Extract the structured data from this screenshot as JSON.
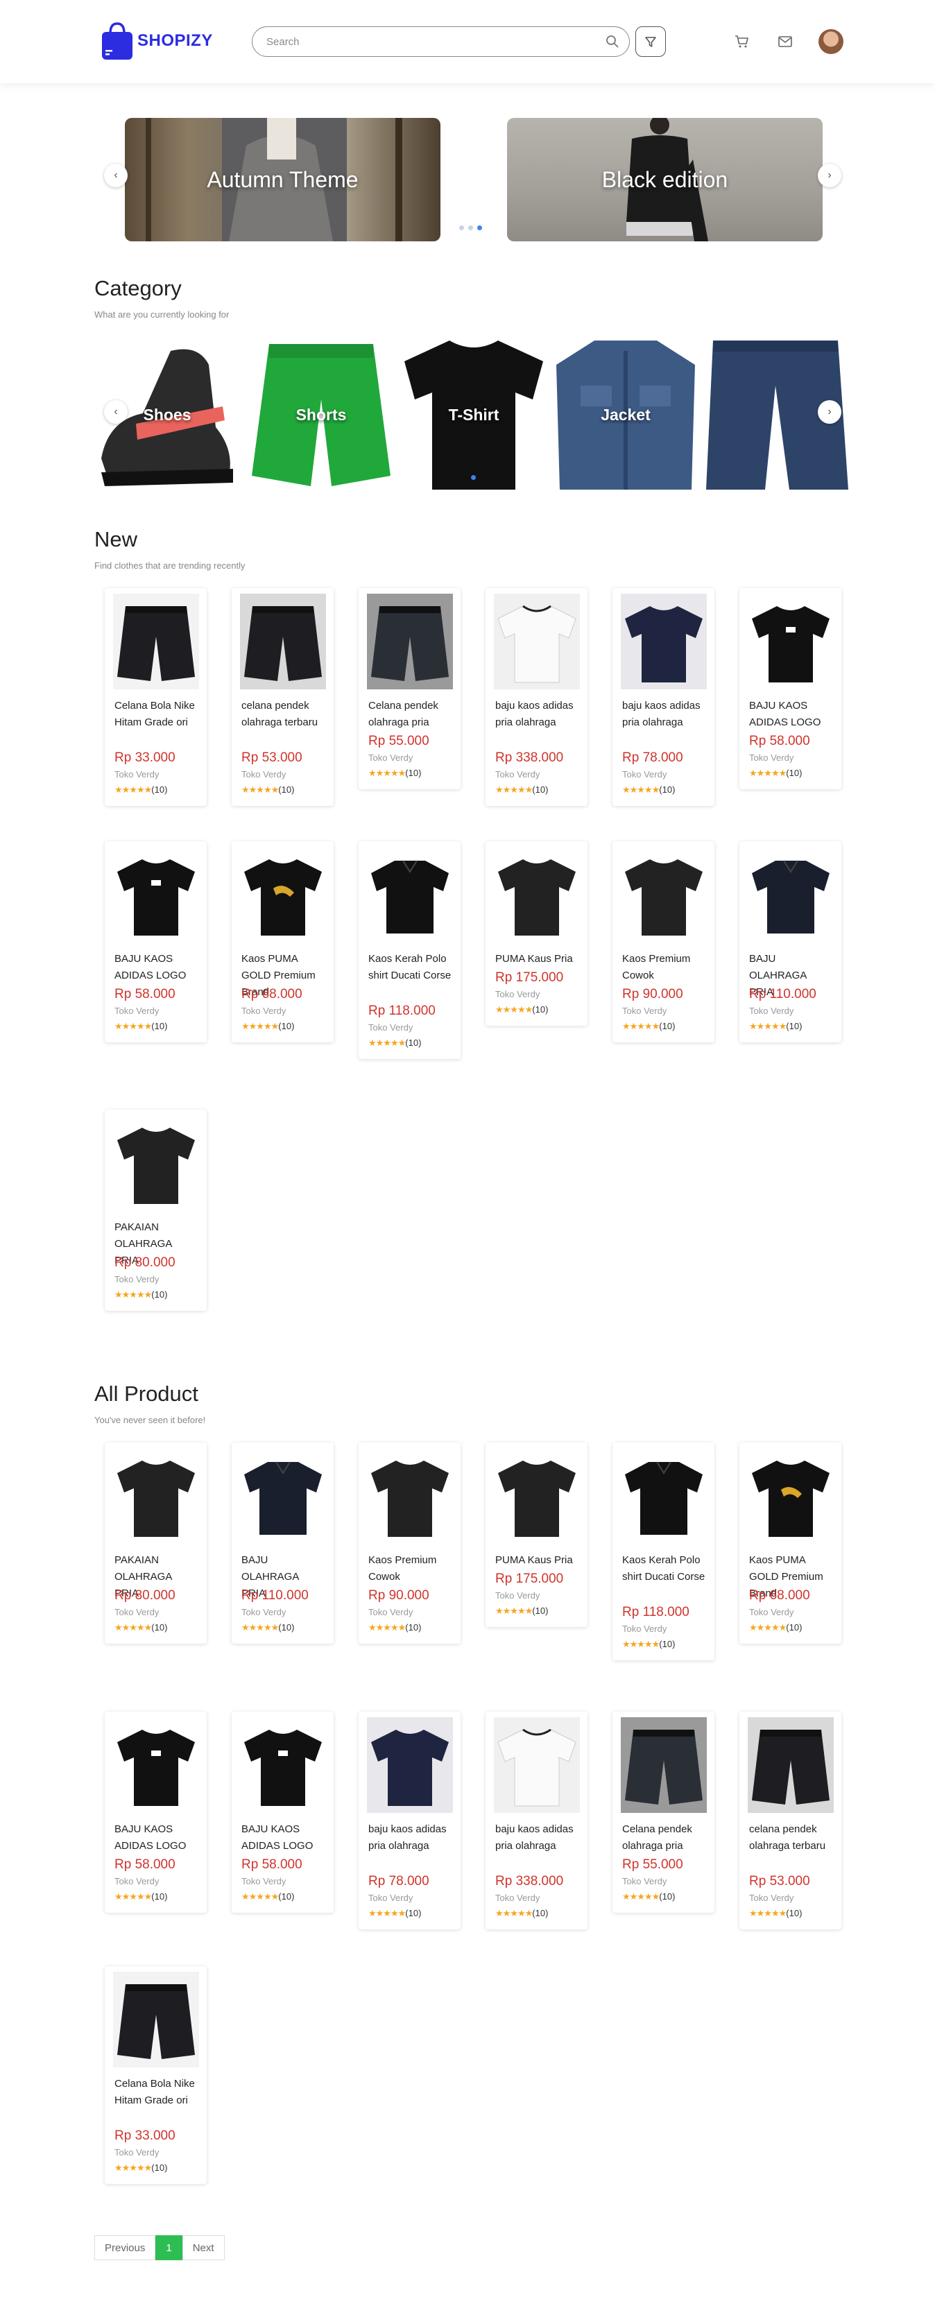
{
  "header": {
    "brand": "SHOPIZY",
    "search_placeholder": "Search",
    "brand_color": "#2c2ce0"
  },
  "banners": [
    {
      "label": "Autumn Theme"
    },
    {
      "label": "Black edition"
    }
  ],
  "category": {
    "title": "Category",
    "subtitle": "What are you currently looking for",
    "items": [
      "Shoes",
      "Shorts",
      "T-Shirt",
      "Jacket",
      ""
    ]
  },
  "new": {
    "title": "New",
    "subtitle": "Find clothes that are trending recently"
  },
  "all": {
    "title": "All Product",
    "subtitle": "You've never seen it before!"
  },
  "new_products": [
    {
      "name": "Celana Bola Nike Hitam Grade ori",
      "price": "Rp 33.000",
      "store": "Toko Verdy",
      "reviews": "(10)",
      "img": "shorts-black"
    },
    {
      "name": "celana pendek olahraga terbaru",
      "price": "Rp 53.000",
      "store": "Toko Verdy",
      "reviews": "(10)",
      "img": "shorts-flat"
    },
    {
      "name": "Celana pendek olahraga pria",
      "price": "Rp 55.000",
      "store": "Toko Verdy",
      "reviews": "(10)",
      "img": "shorts-grey"
    },
    {
      "name": "baju kaos adidas pria olahraga",
      "price": "Rp 338.000",
      "store": "Toko Verdy",
      "reviews": "(10)",
      "img": "tee-white"
    },
    {
      "name": "baju kaos adidas pria olahraga",
      "price": "Rp 78.000",
      "store": "Toko Verdy",
      "reviews": "(10)",
      "img": "tee-navy"
    },
    {
      "name": "BAJU KAOS ADIDAS LOGO",
      "price": "Rp 58.000",
      "store": "Toko Verdy",
      "reviews": "(10)",
      "img": "tee-black"
    },
    {
      "name": "BAJU KAOS ADIDAS LOGO",
      "price": "Rp 58.000",
      "store": "Toko Verdy",
      "reviews": "(10)",
      "img": "tee-black"
    },
    {
      "name": "Kaos PUMA GOLD Premium Brand",
      "price": "Rp 68.000",
      "store": "Toko Verdy",
      "reviews": "(10)",
      "img": "tee-puma"
    },
    {
      "name": "Kaos Kerah Polo shirt Ducati Corse",
      "price": "Rp 118.000",
      "store": "Toko Verdy",
      "reviews": "(10)",
      "img": "polo-black"
    },
    {
      "name": "PUMA Kaus Pria",
      "price": "Rp 175.000",
      "store": "Toko Verdy",
      "reviews": "(10)",
      "img": "tee-dark"
    },
    {
      "name": "Kaos Premium Cowok",
      "price": "Rp 90.000",
      "store": "Toko Verdy",
      "reviews": "(10)",
      "img": "tee-dark"
    },
    {
      "name": "BAJU OLAHRAGA PRIA",
      "price": "Rp 110.000",
      "store": "Toko Verdy",
      "reviews": "(10)",
      "img": "polo-navy"
    },
    {
      "name": "PAKAIAN OLAHRAGA PRIA",
      "price": "Rp 80.000",
      "store": "Toko Verdy",
      "reviews": "(10)",
      "img": "tee-dark"
    }
  ],
  "all_products": [
    {
      "name": "PAKAIAN OLAHRAGA PRIA",
      "price": "Rp 80.000",
      "store": "Toko Verdy",
      "reviews": "(10)",
      "img": "tee-dark"
    },
    {
      "name": "BAJU OLAHRAGA PRIA",
      "price": "Rp 110.000",
      "store": "Toko Verdy",
      "reviews": "(10)",
      "img": "polo-navy"
    },
    {
      "name": "Kaos Premium Cowok",
      "price": "Rp 90.000",
      "store": "Toko Verdy",
      "reviews": "(10)",
      "img": "tee-dark"
    },
    {
      "name": "PUMA Kaus Pria",
      "price": "Rp 175.000",
      "store": "Toko Verdy",
      "reviews": "(10)",
      "img": "tee-dark"
    },
    {
      "name": "Kaos Kerah Polo shirt Ducati Corse",
      "price": "Rp 118.000",
      "store": "Toko Verdy",
      "reviews": "(10)",
      "img": "polo-black"
    },
    {
      "name": "Kaos PUMA GOLD Premium Brand",
      "price": "Rp 68.000",
      "store": "Toko Verdy",
      "reviews": "(10)",
      "img": "tee-puma"
    },
    {
      "name": "BAJU KAOS ADIDAS LOGO",
      "price": "Rp 58.000",
      "store": "Toko Verdy",
      "reviews": "(10)",
      "img": "tee-black"
    },
    {
      "name": "BAJU KAOS ADIDAS LOGO",
      "price": "Rp 58.000",
      "store": "Toko Verdy",
      "reviews": "(10)",
      "img": "tee-black"
    },
    {
      "name": "baju kaos adidas pria olahraga",
      "price": "Rp 78.000",
      "store": "Toko Verdy",
      "reviews": "(10)",
      "img": "tee-navy"
    },
    {
      "name": "baju kaos adidas pria olahraga",
      "price": "Rp 338.000",
      "store": "Toko Verdy",
      "reviews": "(10)",
      "img": "tee-white"
    },
    {
      "name": "Celana pendek olahraga pria",
      "price": "Rp 55.000",
      "store": "Toko Verdy",
      "reviews": "(10)",
      "img": "shorts-grey"
    },
    {
      "name": "celana pendek olahraga terbaru",
      "price": "Rp 53.000",
      "store": "Toko Verdy",
      "reviews": "(10)",
      "img": "shorts-flat"
    },
    {
      "name": "Celana Bola Nike Hitam Grade ori",
      "price": "Rp 33.000",
      "store": "Toko Verdy",
      "reviews": "(10)",
      "img": "shorts-black"
    }
  ],
  "pagination": {
    "prev": "Previous",
    "current": "1",
    "next": "Next"
  },
  "colors": {
    "price": "#d0342c",
    "star": "#f5a623",
    "page_active": "#2ebd52",
    "dot_active": "#3b82f6"
  }
}
